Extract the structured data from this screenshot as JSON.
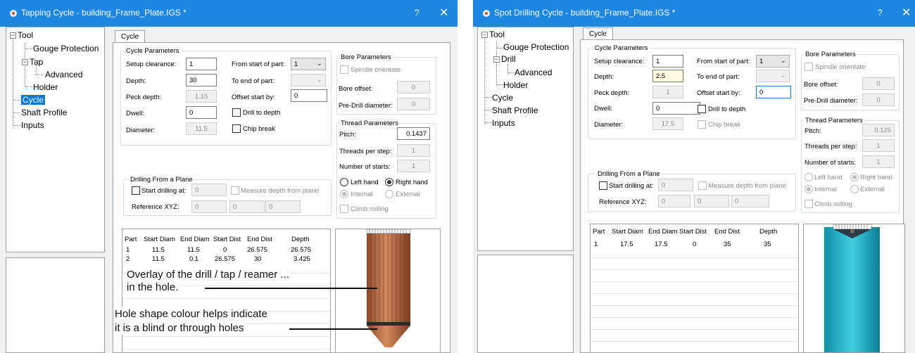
{
  "left": {
    "title": "Tapping Cycle  - building_Frame_Plate.IGS *",
    "help": "?",
    "close": "✕",
    "tree": [
      "Tool",
      "Gouge Protection",
      "Tap",
      "Advanced",
      "Holder",
      "Cycle",
      "Shaft Profile",
      "Inputs"
    ],
    "tab": "Cycle",
    "cycle_params": {
      "title": "Cycle Parameters",
      "setup_clearance_label": "Setup clearance:",
      "setup_clearance": "1",
      "depth_label": "Depth:",
      "depth": "30",
      "peck_depth_label": "Peck depth:",
      "peck_depth": "1.15",
      "dwell_label": "Dwell:",
      "dwell": "0",
      "diameter_label": "Diameter:",
      "diameter": "11.5",
      "from_start_label": "From start of part:",
      "from_start": "1",
      "to_end_label": "To end of part:",
      "to_end": "",
      "offset_start_label": "Offset start by:",
      "offset_start": "0",
      "drill_to_depth": "Drill to depth",
      "chip_break": "Chip break"
    },
    "bore": {
      "title": "Bore Parameters",
      "spindle_orientate": "Spindle orientate",
      "bore_offset_label": "Bore offset:",
      "bore_offset": "0",
      "pre_drill_label": "Pre-Drill diameter:",
      "pre_drill": "0"
    },
    "thread": {
      "title": "Thread Parameters",
      "pitch_label": "Pitch:",
      "pitch": "0.1437",
      "threads_per_step_label": "Threads per step:",
      "threads_per_step": "1",
      "starts_label": "Number of starts:",
      "starts": "1",
      "left_hand": "Left hand",
      "right_hand": "Right hand",
      "internal": "Internal",
      "external": "External",
      "climb": "Climb milling"
    },
    "plane": {
      "title": "Drilling From a Plane",
      "start_drilling": "Start drilling at:",
      "start_value": "0",
      "measure": "Measure depth from plane",
      "ref_label": "Reference XYZ:",
      "x": "0",
      "y": "0",
      "z": "0"
    },
    "table": {
      "headers": [
        "Part",
        "Start Diam",
        "End Diam",
        "Start Dist",
        "End Dist",
        "Depth"
      ],
      "rows": [
        [
          "1",
          "11.5",
          "11.5",
          "0",
          "26.575",
          "26.575"
        ],
        [
          "2",
          "11.5",
          "0.1",
          "26.575",
          "30",
          "3.425"
        ]
      ]
    },
    "annotation1_line1": "Overlay of the drill / tap / reamer ...",
    "annotation1_line2": "in the hole.",
    "annotation2_line1": "Hole shape colour helps indicate",
    "annotation2_line2": "it is a blind or through holes",
    "colors": {
      "titlebar": "#1c86e0",
      "hole": "#b86a3f"
    }
  },
  "right": {
    "title": "Spot Drilling Cycle  - building_Frame_Plate.IGS *",
    "help": "?",
    "close": "✕",
    "tree": [
      "Tool",
      "Gouge Protection",
      "Drill",
      "Advanced",
      "Holder",
      "Cycle",
      "Shaft Profile",
      "Inputs"
    ],
    "tab": "Cycle",
    "cycle_params": {
      "title": "Cycle Parameters",
      "setup_clearance_label": "Setup clearance:",
      "setup_clearance": "1",
      "depth_label": "Depth:",
      "depth": "2.5",
      "peck_depth_label": "Peck depth:",
      "peck_depth": "1",
      "dwell_label": "Dwell:",
      "dwell": "0",
      "diameter_label": "Diameter:",
      "diameter": "17.5",
      "from_start_label": "From start of part:",
      "from_start": "1",
      "to_end_label": "To end of part:",
      "to_end": "",
      "offset_start_label": "Offset start by:",
      "offset_start": "0",
      "drill_to_depth": "Drill to depth",
      "chip_break": "Chip break"
    },
    "bore": {
      "title": "Bore Parameters",
      "spindle_orientate": "Spindle orientate",
      "bore_offset_label": "Bore offset:",
      "bore_offset": "0",
      "pre_drill_label": "Pre-Drill diameter:",
      "pre_drill": "0"
    },
    "thread": {
      "title": "Thread Parameters",
      "pitch_label": "Pitch:",
      "pitch": "0.125",
      "threads_per_step_label": "Threads per step:",
      "threads_per_step": "1",
      "starts_label": "Number of starts:",
      "starts": "1",
      "left_hand": "Left hand",
      "right_hand": "Right hand",
      "internal": "Internal",
      "external": "External",
      "climb": "Climb milling"
    },
    "plane": {
      "title": "Drilling From a Plane",
      "start_drilling": "Start drilling at:",
      "start_value": "0",
      "measure": "Measure depth from plane",
      "ref_label": "Reference XYZ:",
      "x": "0",
      "y": "0",
      "z": "0"
    },
    "table": {
      "headers": [
        "Part",
        "Start Diam",
        "End Diam",
        "Start Dist",
        "End Dist",
        "Depth"
      ],
      "rows": [
        [
          "1",
          "17.5",
          "17.5",
          "0",
          "35",
          "35"
        ]
      ]
    },
    "colors": {
      "titlebar": "#1c86e0",
      "hole": "#1fb7c9"
    }
  }
}
